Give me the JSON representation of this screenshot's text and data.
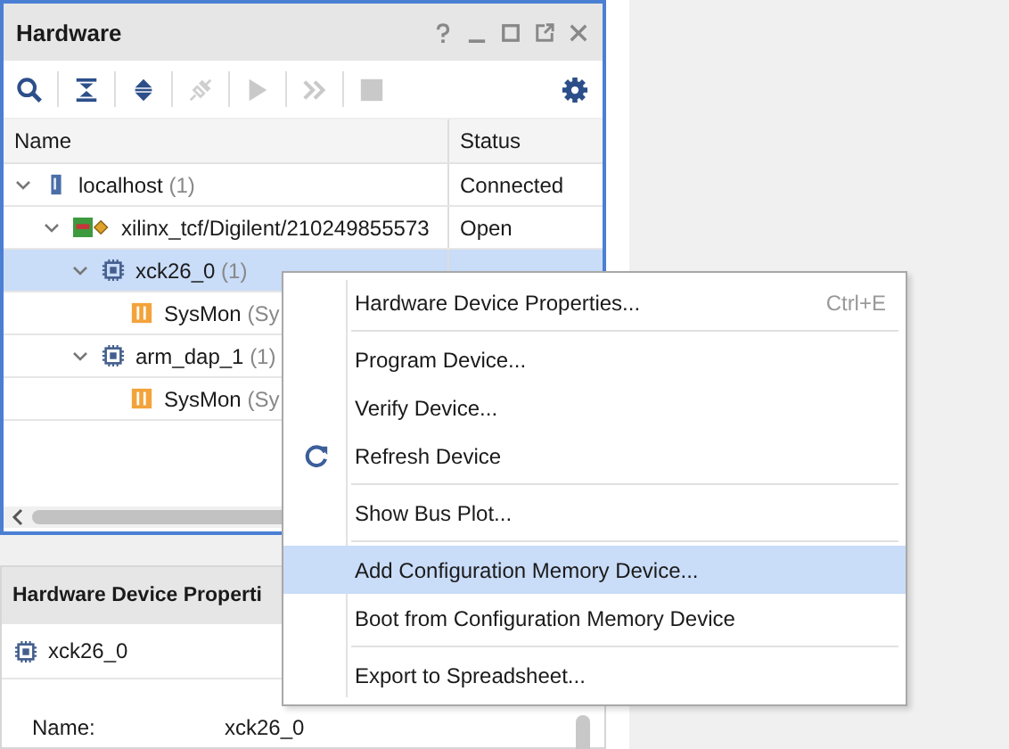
{
  "hardware_panel": {
    "title": "Hardware",
    "window_buttons": [
      {
        "kind": "help"
      },
      {
        "kind": "minimize"
      },
      {
        "kind": "maximize"
      },
      {
        "kind": "float"
      },
      {
        "kind": "close"
      }
    ],
    "toolbar": [
      {
        "kind": "search",
        "disabled": false
      },
      {
        "kind": "collapse",
        "disabled": false
      },
      {
        "kind": "expand",
        "disabled": false
      },
      {
        "kind": "connect",
        "disabled": true
      },
      {
        "kind": "run",
        "disabled": true
      },
      {
        "kind": "step",
        "disabled": true
      },
      {
        "kind": "stop",
        "disabled": true
      },
      {
        "kind": "settings",
        "disabled": false
      }
    ],
    "columns": [
      "Name",
      "Status"
    ],
    "tree": [
      {
        "kind": "host",
        "name": "localhost",
        "count": "(1)",
        "status": "Connected",
        "expanded": true,
        "selected": false,
        "children": [
          {
            "kind": "target",
            "name": "xilinx_tcf/Digilent/210249855573",
            "status": "Open",
            "expanded": true,
            "selected": false,
            "children": [
              {
                "kind": "device",
                "name": "xck26_0",
                "count": "(1)",
                "expanded": true,
                "selected": true,
                "children": [
                  {
                    "kind": "sysmon",
                    "name": "SysMon",
                    "count": "(Sy",
                    "selected": false
                  }
                ]
              },
              {
                "kind": "device",
                "name": "arm_dap_1",
                "count": "(1)",
                "expanded": true,
                "selected": false,
                "children": [
                  {
                    "kind": "sysmon",
                    "name": "SysMon",
                    "count": "(Sy",
                    "selected": false
                  }
                ]
              }
            ]
          }
        ]
      }
    ]
  },
  "context_menu": [
    {
      "label": "Hardware Device Properties...",
      "shortcut": "Ctrl+E",
      "kind": "plain",
      "separator_before": false,
      "selected": false
    },
    {
      "label": "Program Device...",
      "kind": "plain",
      "separator_before": true,
      "selected": false
    },
    {
      "label": "Verify Device...",
      "kind": "plain",
      "separator_before": false,
      "selected": false
    },
    {
      "label": "Refresh Device",
      "kind": "refresh",
      "separator_before": false,
      "selected": false
    },
    {
      "label": "Show Bus Plot...",
      "kind": "plain",
      "separator_before": true,
      "selected": false
    },
    {
      "label": "Add Configuration Memory Device...",
      "kind": "plain",
      "separator_before": true,
      "selected": true
    },
    {
      "label": "Boot from Configuration Memory Device",
      "kind": "plain",
      "separator_before": false,
      "selected": false
    },
    {
      "label": "Export to Spreadsheet...",
      "kind": "plain",
      "separator_before": true,
      "selected": false
    }
  ],
  "properties_panel": {
    "title": "Hardware Device Properti",
    "device": "xck26_0",
    "properties": [
      {
        "label": "Name:",
        "value": "xck26_0"
      }
    ]
  }
}
